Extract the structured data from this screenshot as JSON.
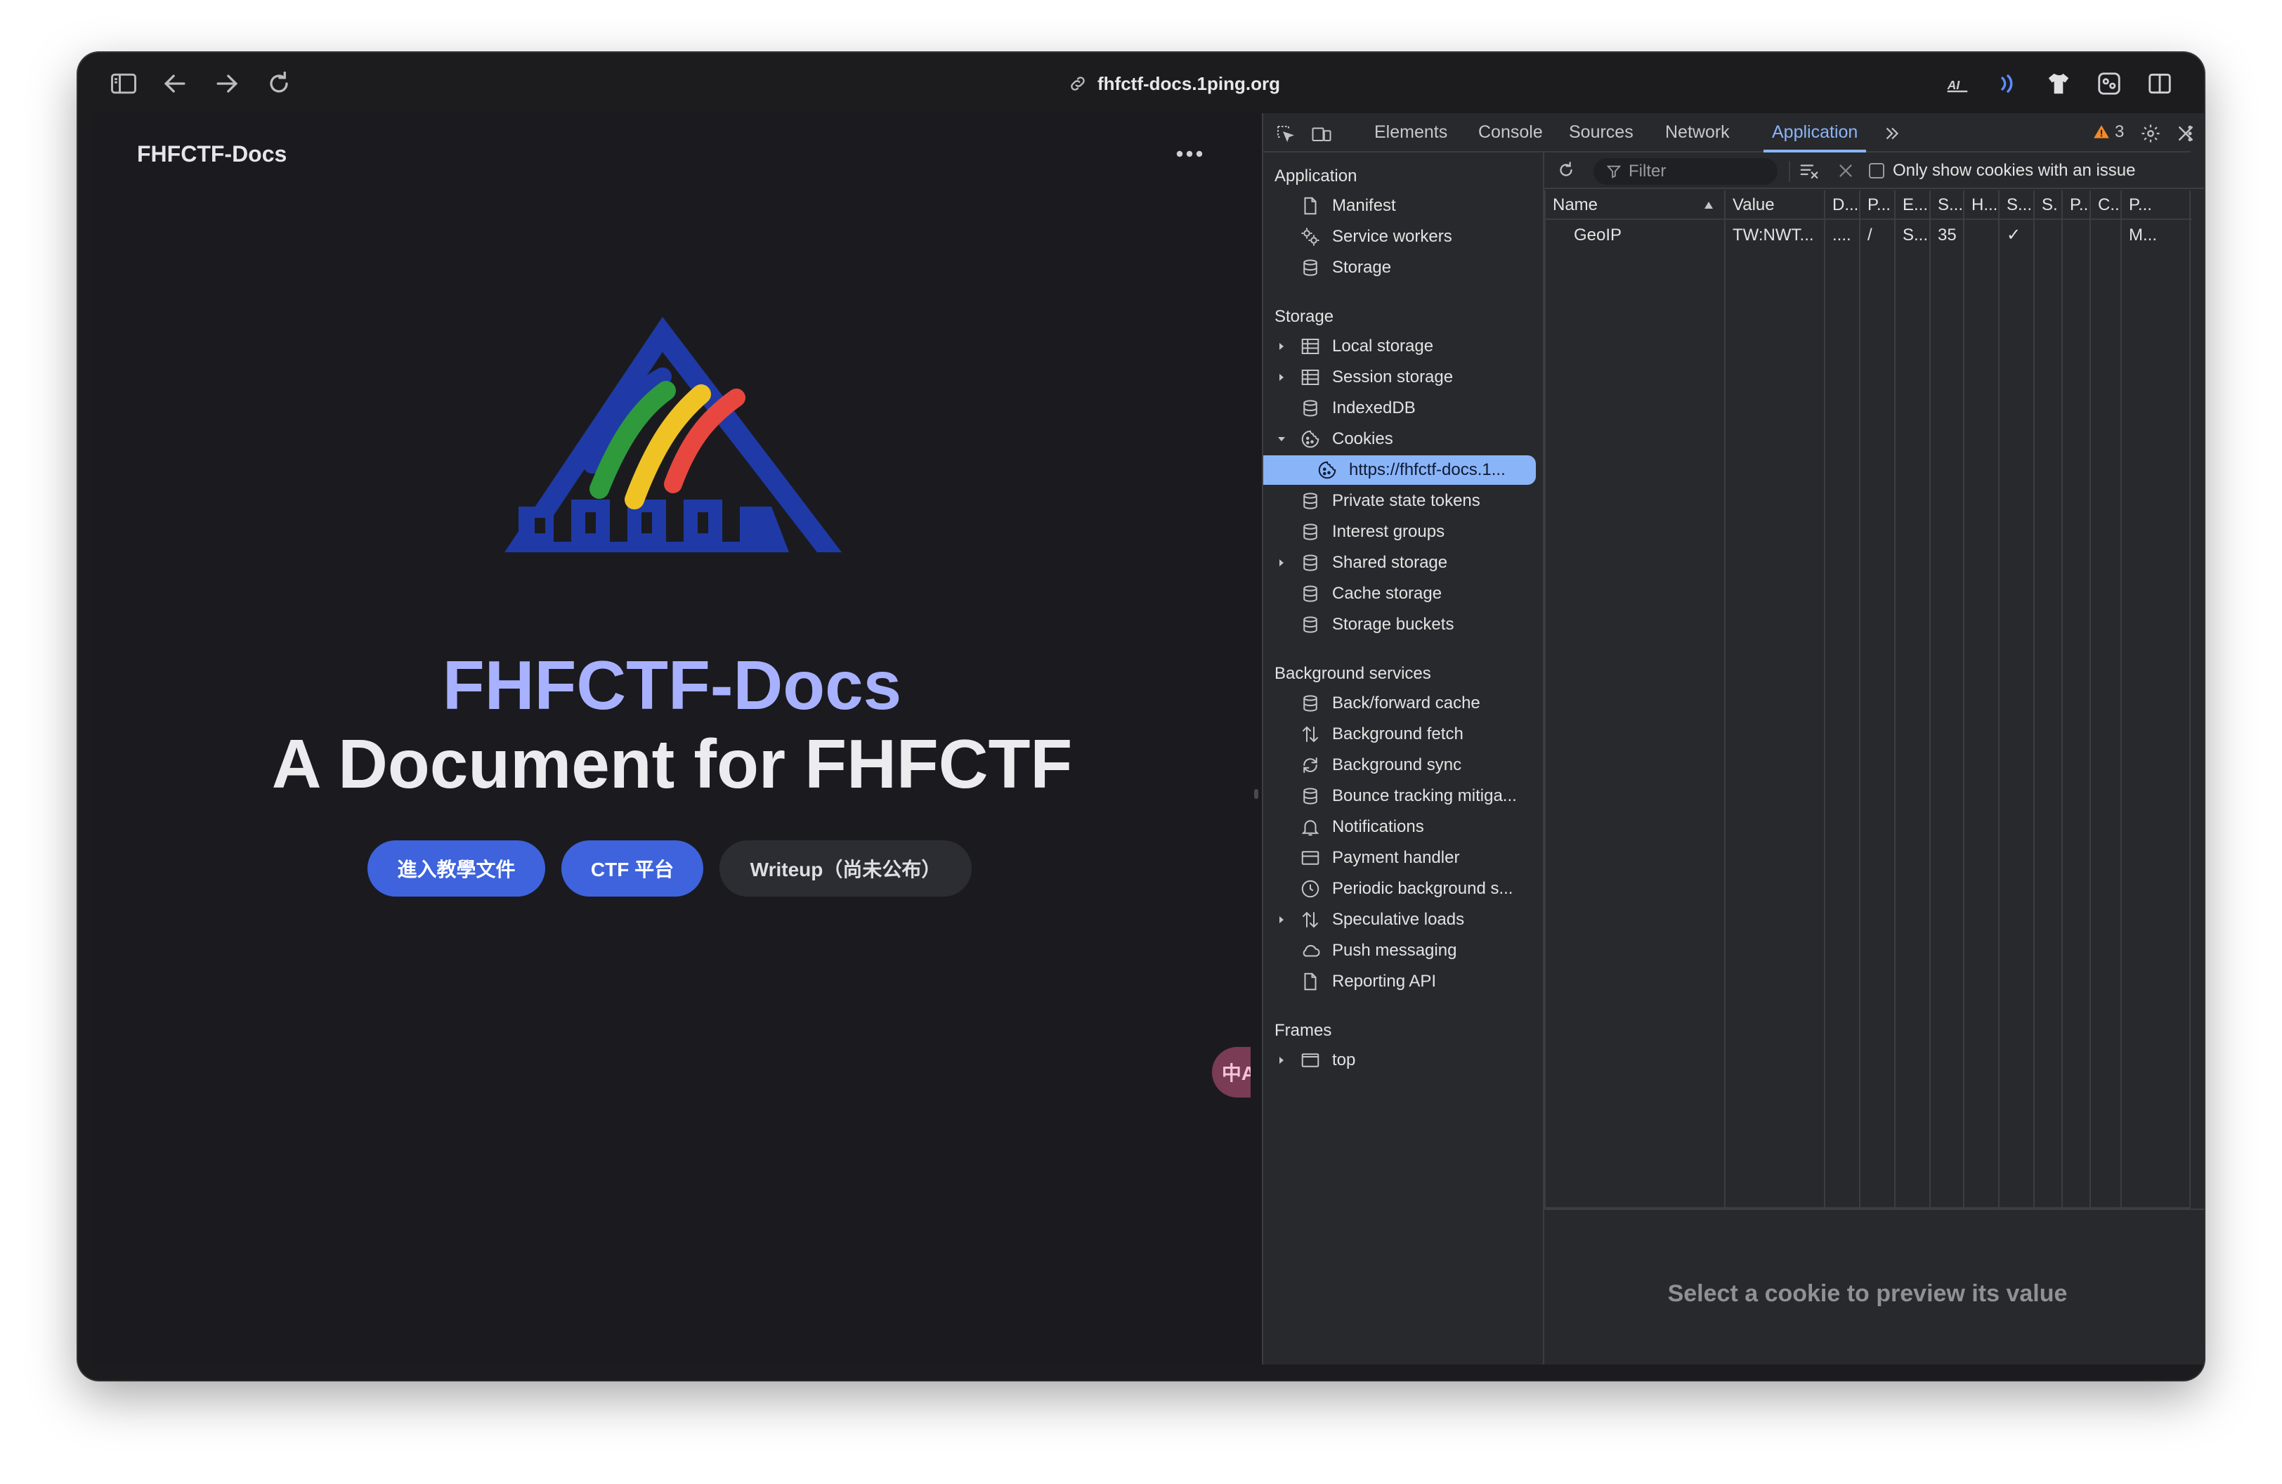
{
  "browser": {
    "url": "fhfctf-docs.1ping.org"
  },
  "page": {
    "site_title": "FHFCTF-Docs",
    "hero_name": "FHFCTF-Docs",
    "hero_text": "A Document for FHFCTF",
    "buttons": {
      "docs": "進入教學文件",
      "ctf": "CTF 平台",
      "writeup": "Writeup（尚未公布）"
    },
    "translate_label": "中A",
    "logo_colors": [
      "#1f3aa6",
      "#2e9a3c",
      "#f0c324",
      "#e8473f"
    ]
  },
  "devtools": {
    "tabs": [
      "Elements",
      "Console",
      "Sources",
      "Network",
      "Application"
    ],
    "active_tab": "Application",
    "warning_count": "3",
    "sidebar": {
      "application_title": "Application",
      "application_items": [
        "Manifest",
        "Service workers",
        "Storage"
      ],
      "storage_title": "Storage",
      "storage_items": [
        "Local storage",
        "Session storage",
        "IndexedDB",
        "Cookies",
        "https://fhfctf-docs.1...",
        "Private state tokens",
        "Interest groups",
        "Shared storage",
        "Cache storage",
        "Storage buckets"
      ],
      "background_title": "Background services",
      "background_items": [
        "Back/forward cache",
        "Background fetch",
        "Background sync",
        "Bounce tracking mitiga...",
        "Notifications",
        "Payment handler",
        "Periodic background s...",
        "Speculative loads",
        "Push messaging",
        "Reporting API"
      ],
      "frames_title": "Frames",
      "frames_items": [
        "top"
      ]
    },
    "cookies": {
      "filter_placeholder": "Filter",
      "only_issue_label": "Only show cookies with an issue",
      "columns": [
        "Name",
        "Value",
        "D...",
        "P...",
        "E...",
        "S...",
        "H...",
        "S...",
        "S.",
        "P...",
        "C...",
        "P..."
      ],
      "row": {
        "name": "GeoIP",
        "value": "TW:NWT...",
        "domain": "....",
        "path": "/",
        "expires": "S...",
        "size": "35",
        "secure": "✓",
        "priority": "M..."
      },
      "preview_text": "Select a cookie to preview its value"
    }
  }
}
